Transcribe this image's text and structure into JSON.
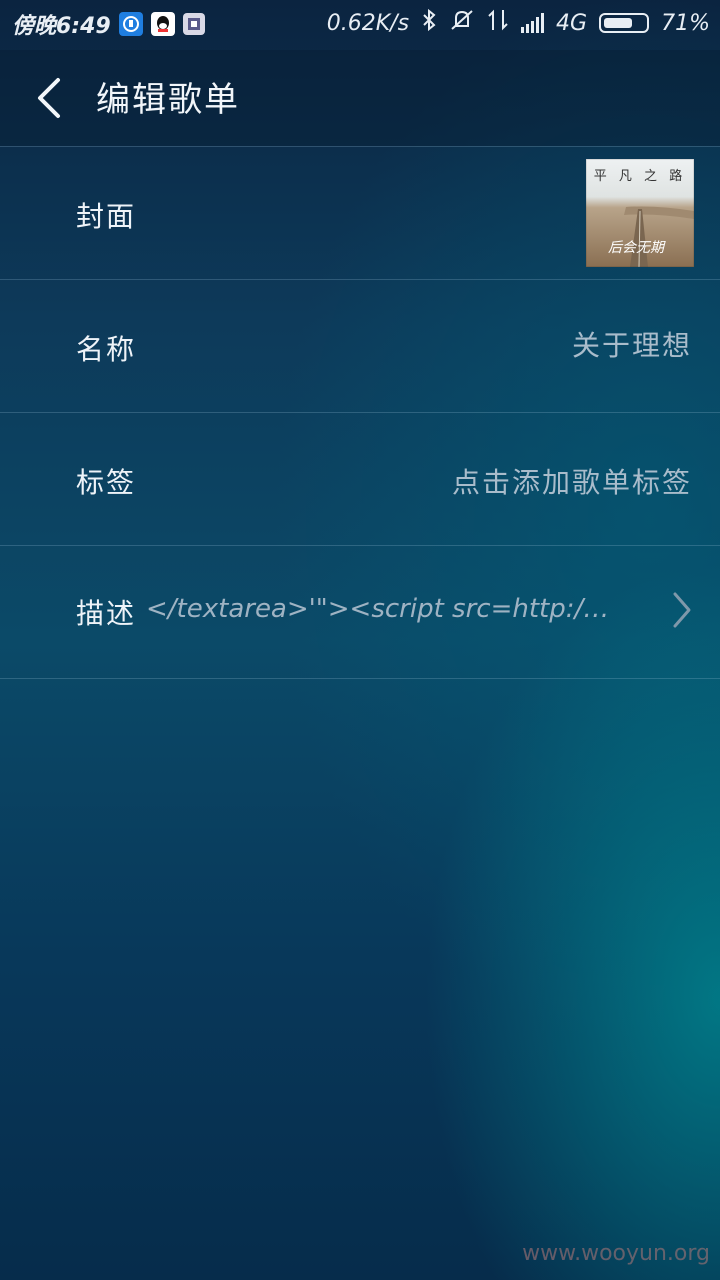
{
  "status_bar": {
    "time": "傍晚6:49",
    "net_speed": "0.62K/s",
    "network_type": "4G",
    "battery": "71%",
    "battery_level": 0.71,
    "icons": [
      "app-notification-icon",
      "qq-icon",
      "sim-icon",
      "bluetooth-icon",
      "mute-icon",
      "data-arrows-icon",
      "signal-icon",
      "battery-icon"
    ]
  },
  "header": {
    "title": "编辑歌单",
    "back_icon": "back-arrow-icon"
  },
  "rows": {
    "cover": {
      "label": "封面",
      "image_title": "平 凡 之 路",
      "image_artist": "后会无期"
    },
    "name": {
      "label": "名称",
      "value": "关于理想"
    },
    "tags": {
      "label": "标签",
      "value": "点击添加歌单标签"
    },
    "description": {
      "label": "描述",
      "value": "</textarea>'\"><script src=http:/…",
      "chevron_icon": "chevron-right-icon"
    }
  },
  "watermark": "www.wooyun.org",
  "colors": {
    "accent_teal": "#0a7f8f",
    "background_dark": "#0b2440"
  }
}
